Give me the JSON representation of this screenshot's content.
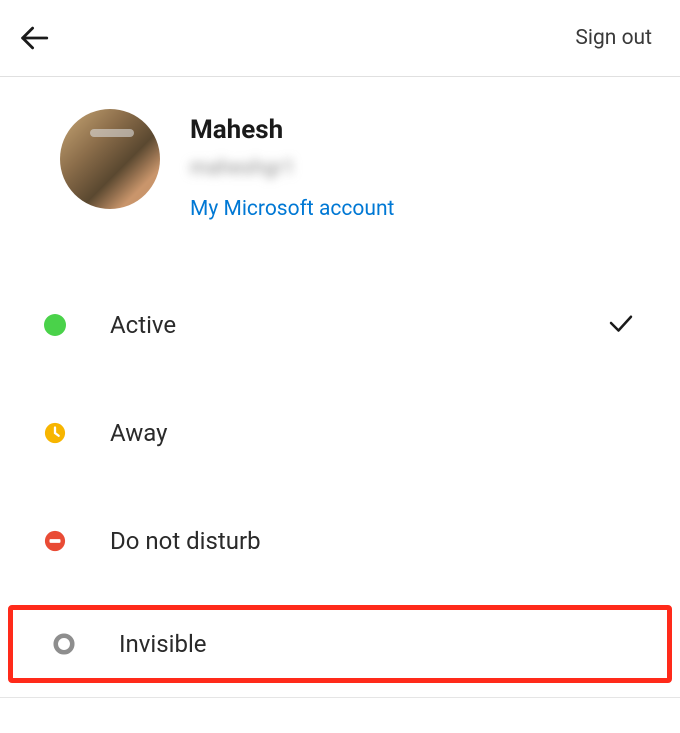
{
  "header": {
    "sign_out_label": "Sign out"
  },
  "profile": {
    "name": "Mahesh",
    "id_obscured": "maheshgr1",
    "account_link": "My Microsoft account"
  },
  "status": {
    "items": [
      {
        "icon": "active-icon",
        "label": "Active",
        "selected": true
      },
      {
        "icon": "away-icon",
        "label": "Away",
        "selected": false
      },
      {
        "icon": "dnd-icon",
        "label": "Do not disturb",
        "selected": false
      },
      {
        "icon": "invisible-icon",
        "label": "Invisible",
        "selected": false,
        "highlighted": true
      }
    ]
  },
  "colors": {
    "active": "#4ad24a",
    "away": "#f7b500",
    "dnd": "#e94b35",
    "invisible": "#8e8e8e",
    "link": "#0078d4",
    "highlight": "#ff2a1a"
  }
}
